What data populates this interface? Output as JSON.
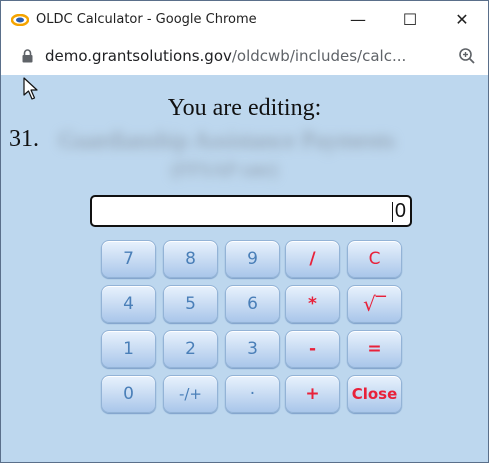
{
  "window": {
    "title": "OLDC Calculator - Google Chrome",
    "minimize": "—",
    "maximize": "☐",
    "close": "✕"
  },
  "address": {
    "host": "demo.grantsolutions.gov",
    "path": "/oldcwb/includes/calc..."
  },
  "page": {
    "heading": "You are editing:",
    "item_number": "31.",
    "item_blurred_line1": "Guardianship Assistance Payments",
    "item_blurred_line2": "(FFSAP rate)"
  },
  "display": {
    "value": "0"
  },
  "keys": [
    [
      "7",
      "8",
      "9",
      "/",
      "C"
    ],
    [
      "4",
      "5",
      "6",
      "*",
      "√‾"
    ],
    [
      "1",
      "2",
      "3",
      "-",
      "="
    ],
    [
      "0",
      "-/+",
      "·",
      "+",
      "Close"
    ]
  ],
  "colors": {
    "content_bg": "#bdd7ee",
    "key_text": "#4a7fb8",
    "operator_text": "#e8213a"
  }
}
